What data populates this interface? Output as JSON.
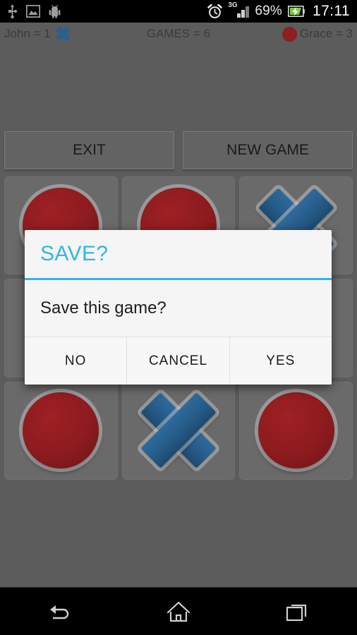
{
  "status_bar": {
    "left_icons": [
      {
        "name": "usb-icon",
        "label": "USB"
      },
      {
        "name": "image-icon",
        "label": "Image"
      },
      {
        "name": "android-icon",
        "label": "Android"
      }
    ],
    "alarm_icon": "alarm-clock-icon",
    "network_type": "3G",
    "signal_icon": "signal-bars-icon",
    "battery_percent": "69%",
    "battery_icon": "battery-charging-icon",
    "clock": "17:11"
  },
  "game_header": {
    "player_left": "John =  1",
    "player_left_mark": "x-mark",
    "games": "GAMES = 6",
    "player_right": "Grace =  3",
    "player_right_mark": "o-mark"
  },
  "top_buttons": {
    "exit": "EXIT",
    "new_game": "NEW GAME"
  },
  "board": {
    "cells": [
      {
        "mark": "O"
      },
      {
        "mark": "O"
      },
      {
        "mark": "X"
      },
      {
        "mark": ""
      },
      {
        "mark": ""
      },
      {
        "mark": ""
      },
      {
        "mark": "O"
      },
      {
        "mark": "X"
      },
      {
        "mark": "O"
      }
    ]
  },
  "dialog": {
    "title": "SAVE?",
    "message": "Save this game?",
    "buttons": [
      {
        "label": "NO",
        "name": "dialog-no-button"
      },
      {
        "label": "CANCEL",
        "name": "dialog-cancel-button"
      },
      {
        "label": "YES",
        "name": "dialog-yes-button"
      }
    ]
  },
  "nav_bar": {
    "back": "back-icon",
    "home": "home-icon",
    "recents": "recent-apps-icon"
  },
  "colors": {
    "accent": "#33b5e5",
    "player_x": "#2c5f8c",
    "player_o": "#8c1f22",
    "app_background": "#5c5c5c",
    "dialog_background": "#f5f5f5"
  }
}
